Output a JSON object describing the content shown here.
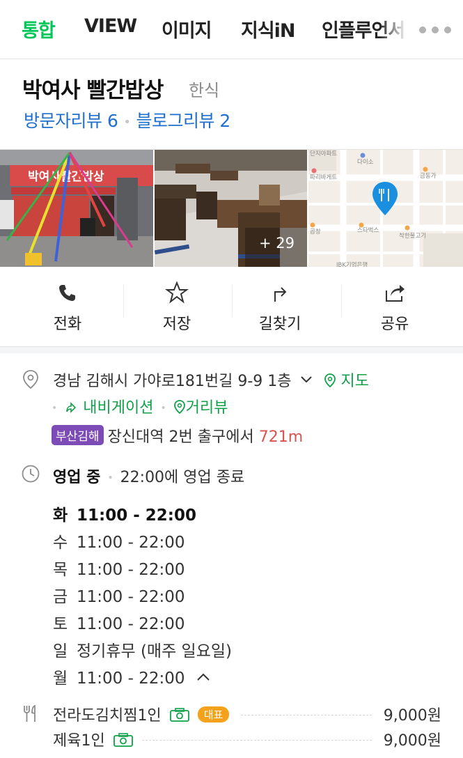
{
  "tabs": [
    "통합",
    "VIEW",
    "이미지",
    "지식iN",
    "인플루언서"
  ],
  "place": {
    "name": "박여사 빨간밥상",
    "category": "한식",
    "visitor_review": "방문자리뷰 6",
    "blog_review": "블로그리뷰 2"
  },
  "photos": {
    "sign_text": "박여사빨간밥상",
    "more_count": "+ 29",
    "map_labels": [
      "단지아파트",
      "다이소",
      "금동가",
      "파리바게트",
      "곱창",
      "스타벅스",
      "착한불고기",
      "IBK기업은행"
    ]
  },
  "actions": {
    "call": "전화",
    "save": "저장",
    "directions": "길찾기",
    "share": "공유"
  },
  "address": {
    "text": "경남 김해시 가야로181번길 9-9 1층",
    "map_link": "지도",
    "navigation_link": "내비게이션",
    "street_view_link": "거리뷰"
  },
  "subway": {
    "line_badge": "부산김해",
    "station": "장신대역",
    "exit_text": "2번 출구에서",
    "distance": "721m"
  },
  "hours": {
    "status": "영업 중",
    "close_info": "22:00에 영업 종료",
    "schedule": [
      {
        "day": "화",
        "time": "11:00 - 22:00"
      },
      {
        "day": "수",
        "time": "11:00 - 22:00"
      },
      {
        "day": "목",
        "time": "11:00 - 22:00"
      },
      {
        "day": "금",
        "time": "11:00 - 22:00"
      },
      {
        "day": "토",
        "time": "11:00 - 22:00"
      },
      {
        "day": "일",
        "time": "정기휴무 (매주 일요일)"
      },
      {
        "day": "월",
        "time": "11:00 - 22:00"
      }
    ]
  },
  "menu": [
    {
      "name": "전라도김치찜1인",
      "badge": "대표",
      "price": "9,000원"
    },
    {
      "name": "제육1인",
      "badge": "",
      "price": "9,000원"
    }
  ],
  "colors": {
    "accent_green": "#03c75a",
    "link_blue": "#1f6fcf",
    "subway_purple": "#7d4bb6",
    "distance_red": "#d9534f",
    "rep_badge_orange": "#f4a21c"
  }
}
